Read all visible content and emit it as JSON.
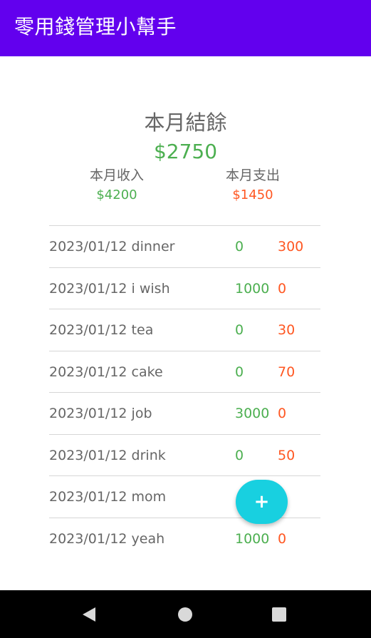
{
  "app_bar": {
    "title": "零用錢管理小幫手"
  },
  "summary": {
    "balance_label": "本月結餘",
    "balance_value": "$2750",
    "income_label": "本月收入",
    "income_value": "$4200",
    "expense_label": "本月支出",
    "expense_value": "$1450"
  },
  "transactions": [
    {
      "description": "2023/01/12 dinner",
      "income": "0",
      "expense": "300"
    },
    {
      "description": "2023/01/12 i wish",
      "income": "1000",
      "expense": "0"
    },
    {
      "description": "2023/01/12 tea",
      "income": "0",
      "expense": "30"
    },
    {
      "description": "2023/01/12 cake",
      "income": "0",
      "expense": "70"
    },
    {
      "description": "2023/01/12 job",
      "income": "3000",
      "expense": "0"
    },
    {
      "description": "2023/01/12 drink",
      "income": "0",
      "expense": "50"
    },
    {
      "description": "2023/01/12 mom",
      "income": "",
      "expense": ""
    },
    {
      "description": "2023/01/12 yeah",
      "income": "1000",
      "expense": "0"
    }
  ],
  "fab": {
    "icon": "plus-icon",
    "label": "+"
  },
  "nav_bar": {
    "back_icon": "back-triangle-icon",
    "home_icon": "home-circle-icon",
    "recents_icon": "recents-square-icon"
  },
  "colors": {
    "app_bar": "#6200ee",
    "income": "#4caf50",
    "expense": "#ff5722",
    "fab": "#18d0e0"
  }
}
